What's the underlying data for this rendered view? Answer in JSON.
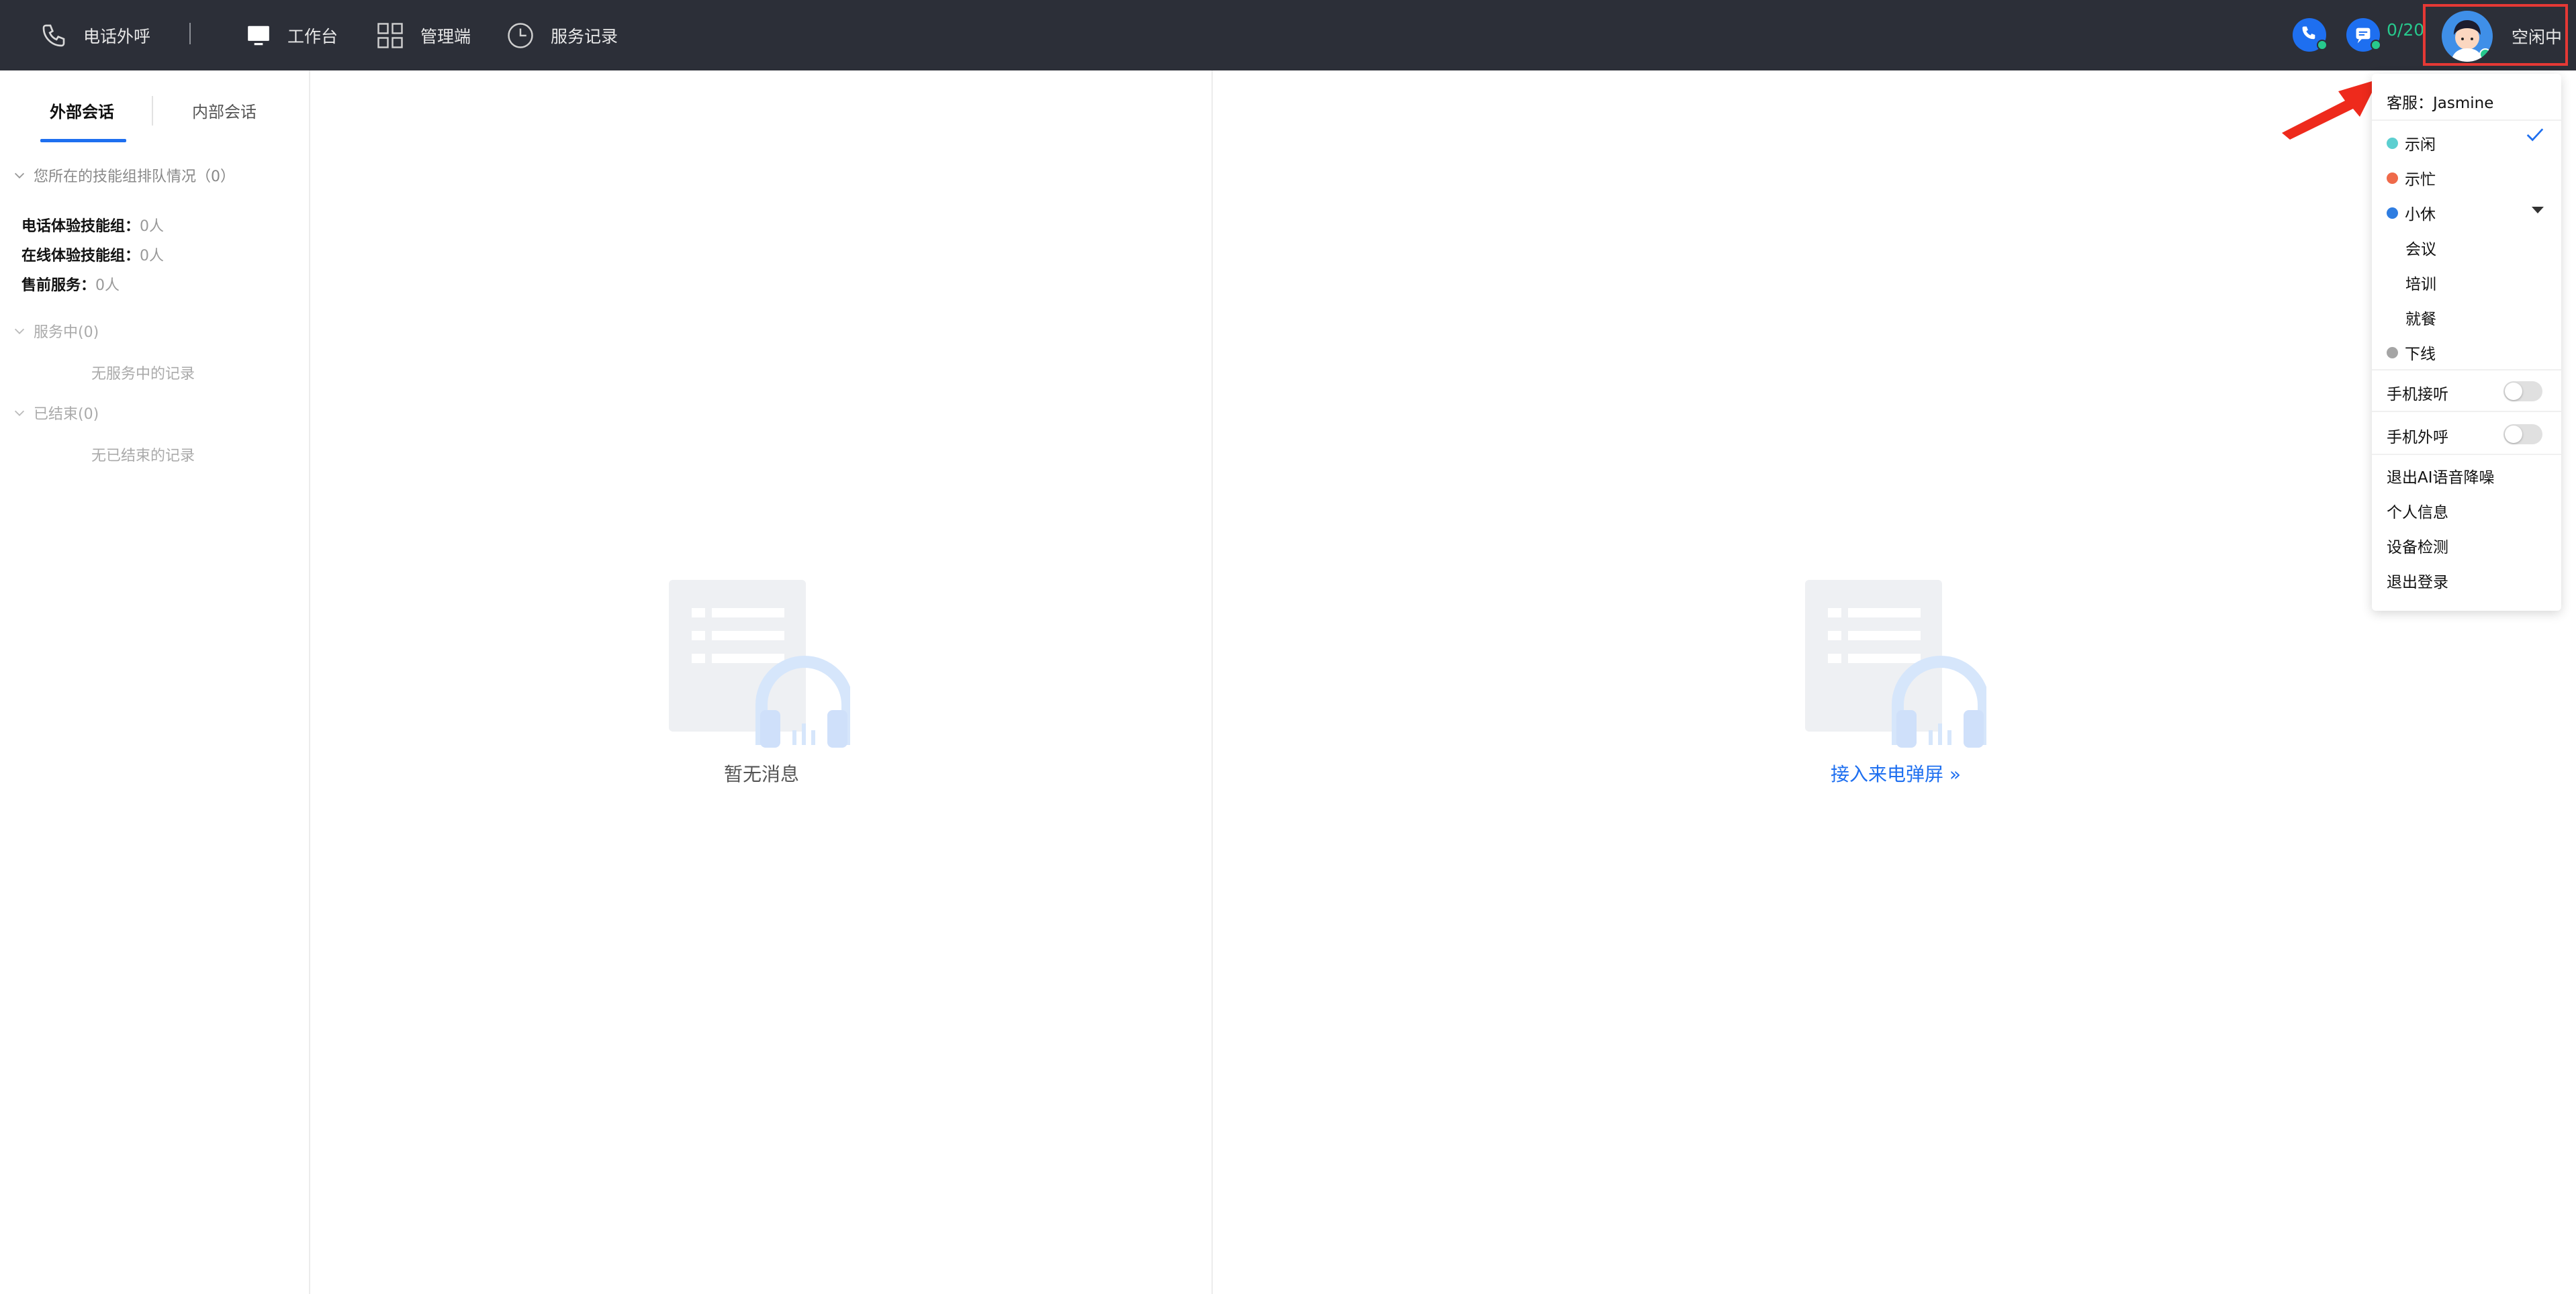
{
  "topbar": {
    "call_out": "电话外呼",
    "workbench": "工作台",
    "admin": "管理端",
    "service_records": "服务记录",
    "counter": "0/20",
    "agent_status": "空闲中"
  },
  "tabs": {
    "external": "外部会话",
    "internal": "内部会话"
  },
  "queue": {
    "heading": "您所在的技能组排队情况（0）",
    "rows": [
      {
        "label": "电话体验技能组：",
        "value": "0人"
      },
      {
        "label": "在线体验技能组：",
        "value": "0人"
      },
      {
        "label": "售前服务：",
        "value": "0人"
      }
    ]
  },
  "in_service": {
    "heading": "服务中(0)",
    "empty": "无服务中的记录"
  },
  "finished": {
    "heading": "已结束(0)",
    "empty": "无已结束的记录"
  },
  "panels": {
    "no_message": "暂无消息",
    "incoming_popup": "接入来电弹屏 »"
  },
  "dropdown": {
    "agent": "客服：Jasmine",
    "statuses": [
      {
        "label": "示闲",
        "color": "#5ccfd0"
      },
      {
        "label": "示忙",
        "color": "#ef6a4a"
      },
      {
        "label": "小休",
        "color": "#2f7de1"
      }
    ],
    "break_options": [
      "会议",
      "培训",
      "就餐"
    ],
    "offline": {
      "label": "下线",
      "color": "#a5a5a5"
    },
    "mobile_answer": "手机接听",
    "mobile_call": "手机外呼",
    "toggles": {
      "mobile_answer_on": false,
      "mobile_call_on": false
    },
    "actions": [
      "退出AI语音降噪",
      "个人信息",
      "设备检测",
      "退出登录"
    ]
  },
  "colors": {
    "topbar": "#2c2f38",
    "accent": "#1e6ff0",
    "online": "#27c98d",
    "highlight": "#e53935"
  }
}
